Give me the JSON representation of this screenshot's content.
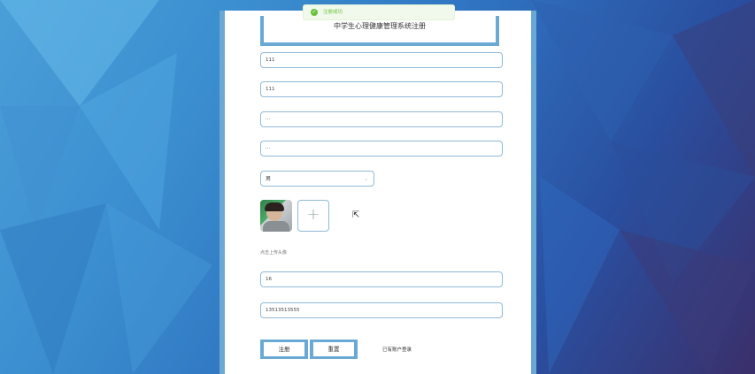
{
  "form": {
    "title": "中学生心理健康管理系统注册",
    "fields": [
      {
        "value": "111"
      },
      {
        "value": "111"
      },
      {
        "value": "···"
      },
      {
        "value": "···"
      }
    ],
    "gender": {
      "value": "男"
    },
    "upload_plus": "+",
    "upload_hint": "点击上传头像",
    "age": {
      "value": "16"
    },
    "phone": {
      "value": "13513513555"
    },
    "register_label": "注册",
    "reset_label": "重置",
    "login_link": "已有账户登录"
  },
  "toast": {
    "message": "注册成功",
    "icon": "check-circle-icon"
  },
  "colors": {
    "accent": "#6aa9d4",
    "success": "#67c23a"
  }
}
